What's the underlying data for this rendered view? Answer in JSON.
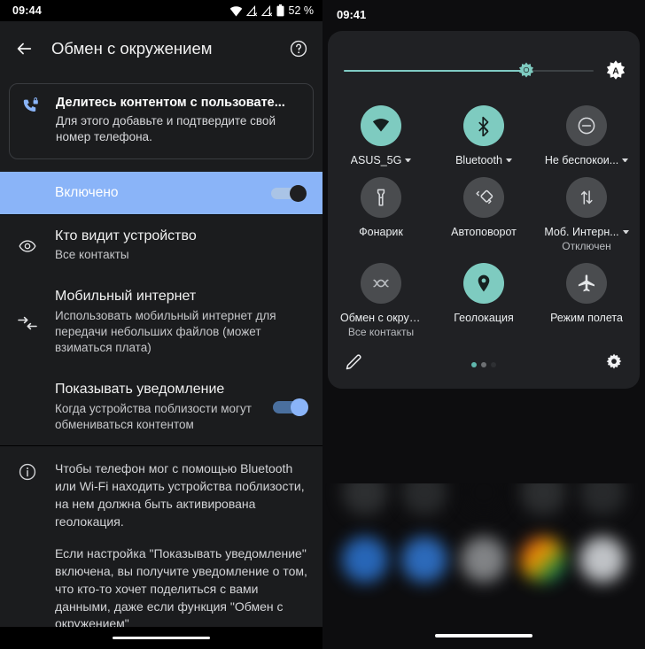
{
  "left": {
    "statusbar": {
      "time": "09:44",
      "battery_percent": "52 %"
    },
    "appbar": {
      "title": "Обмен с окружением",
      "back_icon": "arrow-back-icon",
      "help_icon": "help-circle-icon"
    },
    "card": {
      "icon": "phone-lock-icon",
      "title": "Делитесь контентом с пользовате...",
      "body": "Для этого добавьте и подтвердите свой номер телефона."
    },
    "enabled_row": {
      "label": "Включено",
      "toggle_state": "off"
    },
    "settings": [
      {
        "icon": "eye-icon",
        "title": "Кто видит устройство",
        "subtitle": "Все контакты",
        "has_toggle": false
      },
      {
        "icon": "data-transfer-icon",
        "title": "Мобильный интернет",
        "subtitle": "Использовать мобильный интернет для передачи небольших файлов (может взиматься плата)",
        "has_toggle": false
      },
      {
        "icon": "",
        "title": "Показывать уведомление",
        "subtitle": "Когда устройства поблизости могут обмениваться контентом",
        "has_toggle": true,
        "toggle_state": "on"
      }
    ],
    "footer": {
      "icon": "info-icon",
      "paragraphs": [
        "Чтобы телефон мог с помощью Bluetooth или Wi-Fi находить устройства поблизости, на нем должна быть активирована геолокация.",
        "Если настройка \"Показывать уведомление\" включена, вы получите уведомление о том, что кто-то хочет поделиться с вами данными, даже если функция \"Обмен с окружением\""
      ]
    }
  },
  "right": {
    "statusbar": {
      "time": "09:41"
    },
    "brightness": {
      "icon": "brightness-thumb-icon",
      "auto_icon": "auto-brightness-icon",
      "value_percent": 73
    },
    "tiles": [
      [
        {
          "icon": "wifi-icon",
          "label": "ASUS_5G",
          "state": "active",
          "caret": true,
          "sub": ""
        },
        {
          "icon": "bluetooth-icon",
          "label": "Bluetooth",
          "state": "active",
          "caret": true,
          "sub": ""
        },
        {
          "icon": "do-not-disturb-icon",
          "label": "Не беспокои...",
          "state": "inactive",
          "caret": true,
          "sub": ""
        }
      ],
      [
        {
          "icon": "flashlight-icon",
          "label": "Фонарик",
          "state": "inactive",
          "caret": false,
          "sub": ""
        },
        {
          "icon": "auto-rotate-icon",
          "label": "Автоповорот",
          "state": "inactive",
          "caret": false,
          "sub": ""
        },
        {
          "icon": "mobile-data-icon",
          "label": "Моб. Интерн...",
          "state": "inactive",
          "caret": true,
          "sub": "Отключен"
        }
      ],
      [
        {
          "icon": "nearby-share-icon",
          "label": "Обмен с окруже...",
          "state": "inactive",
          "caret": false,
          "sub": "Все контакты"
        },
        {
          "icon": "location-icon",
          "label": "Геолокация",
          "state": "active",
          "caret": false,
          "sub": ""
        },
        {
          "icon": "airplane-icon",
          "label": "Режим полета",
          "state": "inactive",
          "caret": false,
          "sub": ""
        }
      ]
    ],
    "footer": {
      "edit_icon": "pencil-icon",
      "settings_icon": "gear-icon",
      "page_dots": [
        "on",
        "off",
        "faint"
      ]
    },
    "home_dock_colors": [
      "#2a6ec6",
      "#2f72c9",
      "#8b8d90",
      "#3f8f4e",
      "#cfd2d6"
    ],
    "home_row1_colors": [
      "#303234",
      "#2b2d2f",
      "#2f3133",
      "#2a2c2e"
    ]
  },
  "colors": {
    "accent_blue": "#8ab4f8",
    "accent_teal": "#7ecbc0",
    "panel_bg": "#1b1c1e",
    "qs_bg": "#202124"
  }
}
